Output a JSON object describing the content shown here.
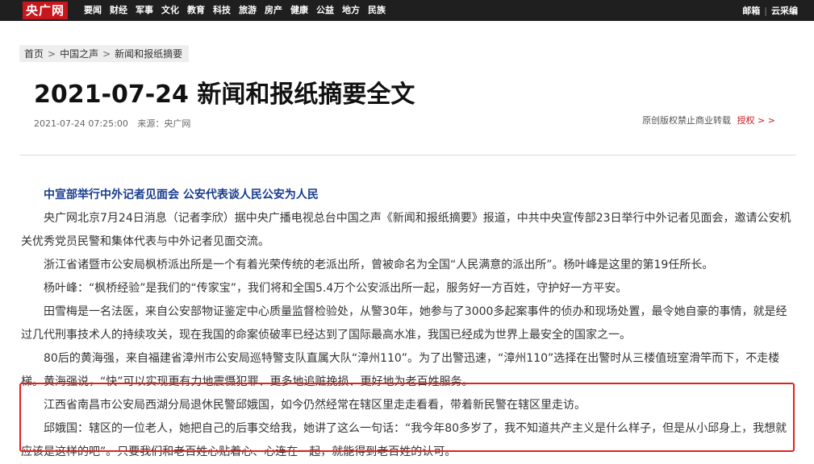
{
  "header": {
    "logo": "央广网",
    "nav": [
      "要闻",
      "财经",
      "军事",
      "文化",
      "教育",
      "科技",
      "旅游",
      "房产",
      "健康",
      "公益",
      "地方",
      "民族"
    ],
    "right": [
      "邮箱",
      "云采编"
    ]
  },
  "breadcrumb": [
    "首页",
    "中国之声",
    "新闻和报纸摘要"
  ],
  "article": {
    "title": "2021-07-24 新闻和报纸摘要全文",
    "datetime": "2021-07-24 07:25:00",
    "source": "来源：央广网",
    "rights_text": "原创版权禁止商业转载",
    "rights_link": "授权 > >",
    "subhead": "中宣部举行中外记者见面会 公安代表谈人民公安为人民",
    "paragraphs": [
      "央广网北京7月24日消息（记者李欣）据中央广播电视总台中国之声《新闻和报纸摘要》报道，中共中央宣传部23日举行中外记者见面会，邀请公安机关优秀党员民警和集体代表与中外记者见面交流。",
      "浙江省诸暨市公安局枫桥派出所是一个有着光荣传统的老派出所，曾被命名为全国“人民满意的派出所”。杨叶峰是这里的第19任所长。",
      "杨叶峰：“枫桥经验”是我们的“传家宝”，我们将和全国5.4万个公安派出所一起，服务好一方百姓，守护好一方平安。",
      "田雪梅是一名法医，来自公安部物证鉴定中心质量监督检验处，从警30年，她参与了3000多起案事件的侦办和现场处置，最令她自豪的事情，就是经过几代刑事技术人的持续攻关，现在我国的命案侦破率已经达到了国际最高水准，我国已经成为世界上最安全的国家之一。",
      "80后的黄海强，来自福建省漳州市公安局巡特警支队直属大队“漳州110”。为了出警迅速，“漳州110”选择在出警时从三楼值班室滑竿而下，不走楼梯。黄海强说，“快”可以实现更有力地震慑犯罪、更多地追赃挽损、更好地为老百姓服务。",
      "江西省南昌市公安局西湖分局退休民警邱娥国，如今仍然经常在辖区里走走看看，带着新民警在辖区里走访。",
      "邱娥国：辖区的一位老人，她把自己的后事交给我，她讲了这么一句话：“我今年80多岁了，我不知道共产主义是什么样子，但是从小邱身上，我想就应该是这样的吧”。只要我们和老百姓心贴着心、心连在一起，就能得到老百姓的认可。"
    ]
  },
  "colors": {
    "logo_red": "#c8161d",
    "topbar": "#1f1f1f",
    "subhead_blue": "#1a3d8f",
    "highlight_border": "#e3201f"
  }
}
